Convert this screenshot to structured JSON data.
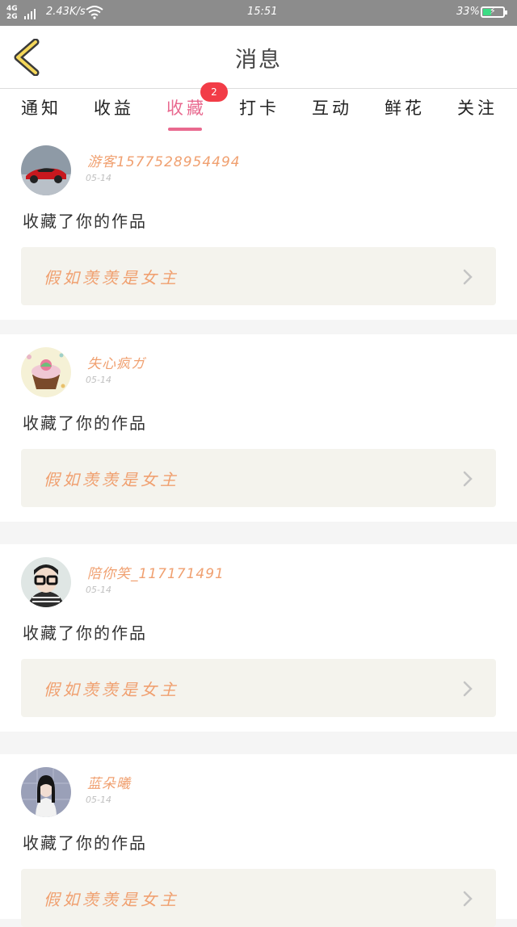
{
  "status_bar": {
    "network": "4G",
    "network2": "2G",
    "speed": "2.43K/s",
    "time": "15:51",
    "battery": "33%"
  },
  "header": {
    "title": "消息"
  },
  "tabs": [
    {
      "label": "通知"
    },
    {
      "label": "收益"
    },
    {
      "label": "收藏",
      "active": true,
      "badge": "2"
    },
    {
      "label": "打卡"
    },
    {
      "label": "互动"
    },
    {
      "label": "鲜花"
    },
    {
      "label": "关注"
    }
  ],
  "messages": [
    {
      "username": "游客1577528954494",
      "date": "05-14",
      "action": "收藏了你的作品",
      "work_title": "假如羡羡是女主",
      "avatar_icon": "red-car-avatar"
    },
    {
      "username": "失心疯ガ",
      "date": "05-14",
      "action": "收藏了你的作品",
      "work_title": "假如羡羡是女主",
      "avatar_icon": "cupcake-avatar"
    },
    {
      "username": "陪你笑_117171491",
      "date": "05-14",
      "action": "收藏了你的作品",
      "work_title": "假如羡羡是女主",
      "avatar_icon": "boy-glasses-avatar"
    },
    {
      "username": "蓝朵曦",
      "date": "05-14",
      "action": "收藏了你的作品",
      "work_title": "假如羡羡是女主",
      "avatar_icon": "girl-photo-avatar"
    }
  ],
  "colors": {
    "accent": "#e9698f",
    "badge": "#f23c47",
    "username": "#f0a070",
    "work_bg": "#f4f3ed"
  }
}
